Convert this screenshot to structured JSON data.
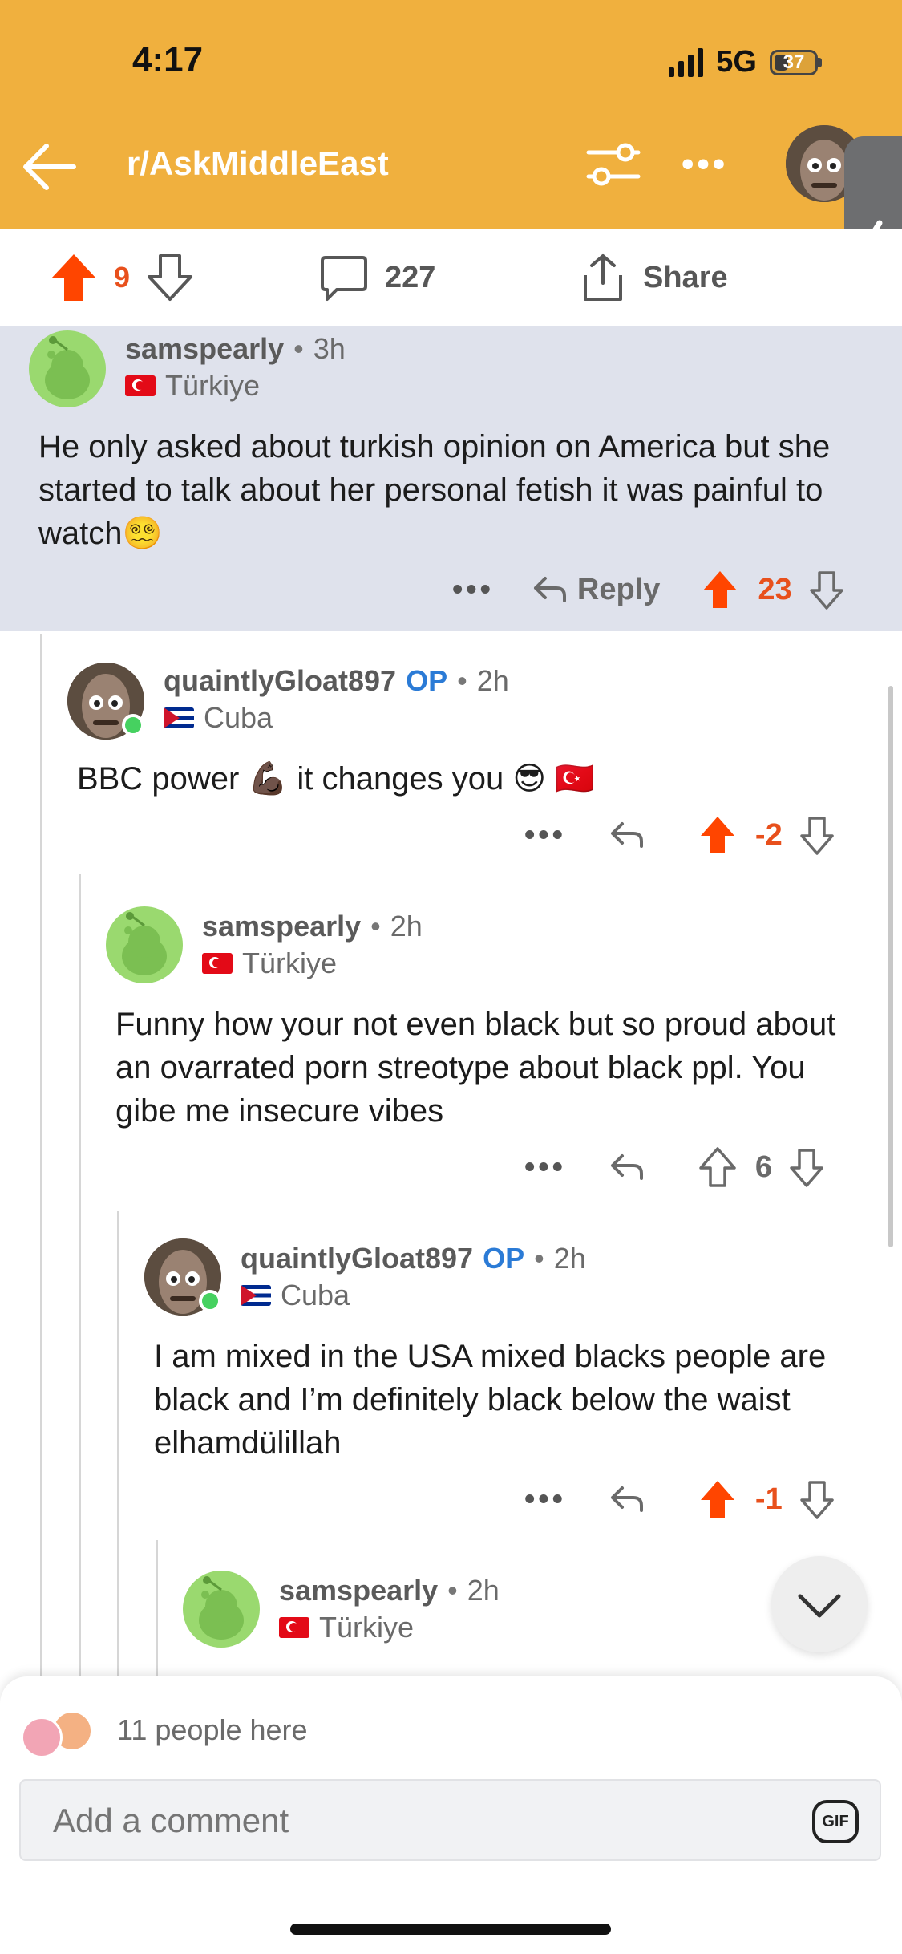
{
  "status": {
    "time": "4:17",
    "network": "5G",
    "battery": "37"
  },
  "nav": {
    "title": "r/AskMiddleEast"
  },
  "post_actions": {
    "upvotes": "9",
    "comments": "227",
    "share": "Share"
  },
  "comments": [
    {
      "username": "samspearly",
      "age": "3h",
      "flair": "Türkiye",
      "op": "",
      "text": "He only asked about turkish opinion on America but she started to talk about her personal fetish it was painful to watch😵‍💫",
      "reply_label": "Reply",
      "score": "23"
    },
    {
      "username": "quaintlyGloat897",
      "age": "2h",
      "flair": "Cuba",
      "op": "OP",
      "text": "BBC power 💪🏿 it changes you 😎 🇹🇷",
      "score": "-2"
    },
    {
      "username": "samspearly",
      "age": "2h",
      "flair": "Türkiye",
      "op": "",
      "text": "Funny how your not even black but so proud about an ovarrated porn streotype about black ppl. You gibe me insecure vibes",
      "score": "6"
    },
    {
      "username": "quaintlyGloat897",
      "age": "2h",
      "flair": "Cuba",
      "op": "OP",
      "text": "I am mixed in the USA mixed blacks people are black and I’m definitely black below the waist elhamdülillah",
      "score": "-1"
    },
    {
      "username": "samspearly",
      "age": "2h",
      "flair": "Türkiye",
      "op": ""
    }
  ],
  "presence": {
    "text": "11 people here"
  },
  "composer": {
    "placeholder": "Add a comment",
    "gif": "GIF"
  },
  "colors": {
    "header": "#f0b03e",
    "upvote": "#ff4500",
    "op": "#2b7bd6"
  }
}
